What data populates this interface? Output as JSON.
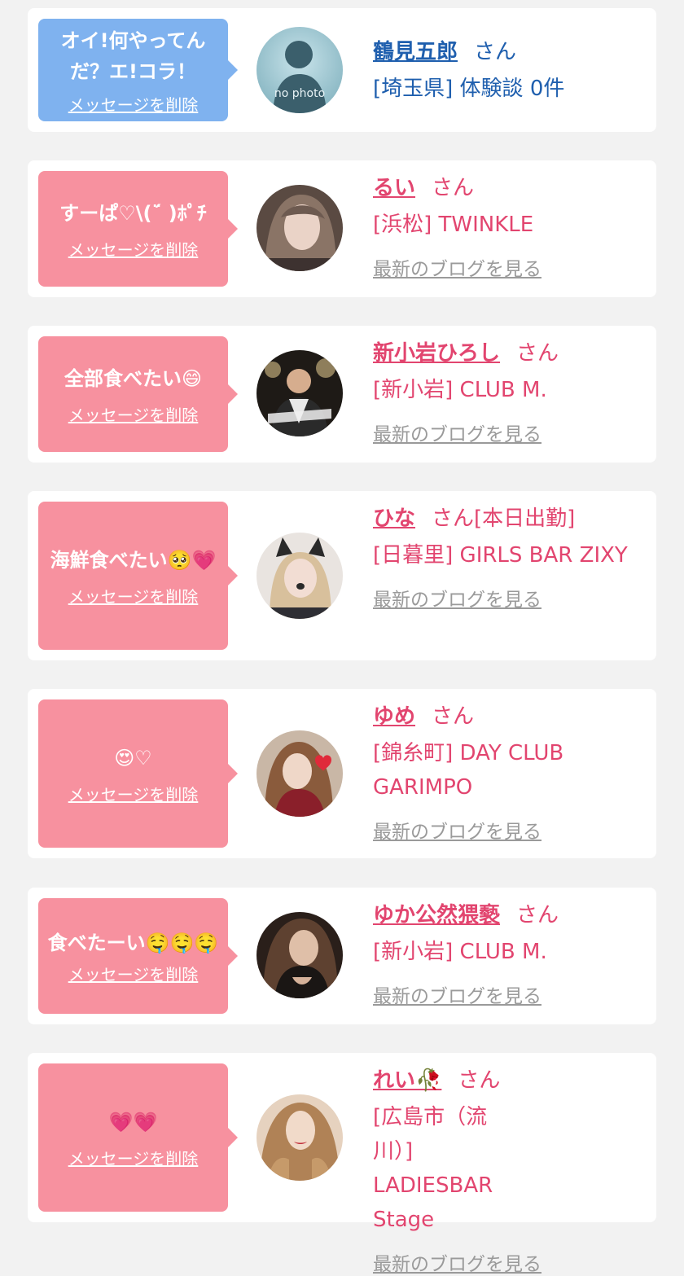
{
  "colors": {
    "background": "#f2f2f2",
    "card": "#ffffff",
    "bubble_blue": "#7fb2ef",
    "bubble_pink": "#f7919f",
    "name_pink": "#e2456f",
    "name_blue": "#1f5fae",
    "link_gray": "#9a9a9a"
  },
  "entries": [
    {
      "message": "オイ!何やってんだ？エ!コラ！",
      "delete_label": "メッセージを削除",
      "avatar_icon": "no-photo-silhouette-icon",
      "avatar_text": "no photo",
      "name": "鶴見五郎",
      "honorific": "さん",
      "status": "",
      "shop": "[埼玉県] 体験談 0件",
      "blog_label": ""
    },
    {
      "message": "すーぱ♡\\(ˊ̈ )ﾎﾟﾁ",
      "delete_label": "メッセージを削除",
      "avatar_icon": "user-photo-icon",
      "name": "るい",
      "honorific": "さん",
      "status": "",
      "shop": "[浜松] TWINKLE",
      "blog_label": "最新のブログを見る"
    },
    {
      "message": "全部食べたい😄",
      "delete_label": "メッセージを削除",
      "avatar_icon": "user-photo-icon",
      "name": "新小岩ひろし",
      "honorific": "さん",
      "status": "",
      "shop": "[新小岩] CLUB M.",
      "blog_label": "最新のブログを見る"
    },
    {
      "message": "海鮮食べたい🥺💗",
      "delete_label": "メッセージを削除",
      "avatar_icon": "user-photo-icon",
      "name": "ひな",
      "honorific": "さん",
      "status": "[本日出勤]",
      "shop": "[日暮里] GIRLS BAR ZIXY",
      "blog_label": "最新のブログを見る"
    },
    {
      "message": "😍♡",
      "delete_label": "メッセージを削除",
      "avatar_icon": "user-photo-icon",
      "name": "ゆめ",
      "honorific": "さん",
      "status": "",
      "shop": "[錦糸町] DAY CLUB GARIMPO",
      "blog_label": "最新のブログを見る"
    },
    {
      "message": "食べたーい🤤🤤🤤",
      "delete_label": "メッセージを削除",
      "avatar_icon": "user-photo-icon",
      "name": "ゆか公然猥褻",
      "honorific": "さん",
      "status": "",
      "shop": "[新小岩] CLUB M.",
      "blog_label": "最新のブログを見る"
    },
    {
      "message": "💗💗",
      "delete_label": "メッセージを削除",
      "avatar_icon": "user-photo-icon",
      "name": "れい🥀",
      "honorific": "さん",
      "status": "",
      "shop": "[広島市（流川）] LADIESBAR Stage",
      "blog_label": "最新のブログを見る"
    }
  ]
}
